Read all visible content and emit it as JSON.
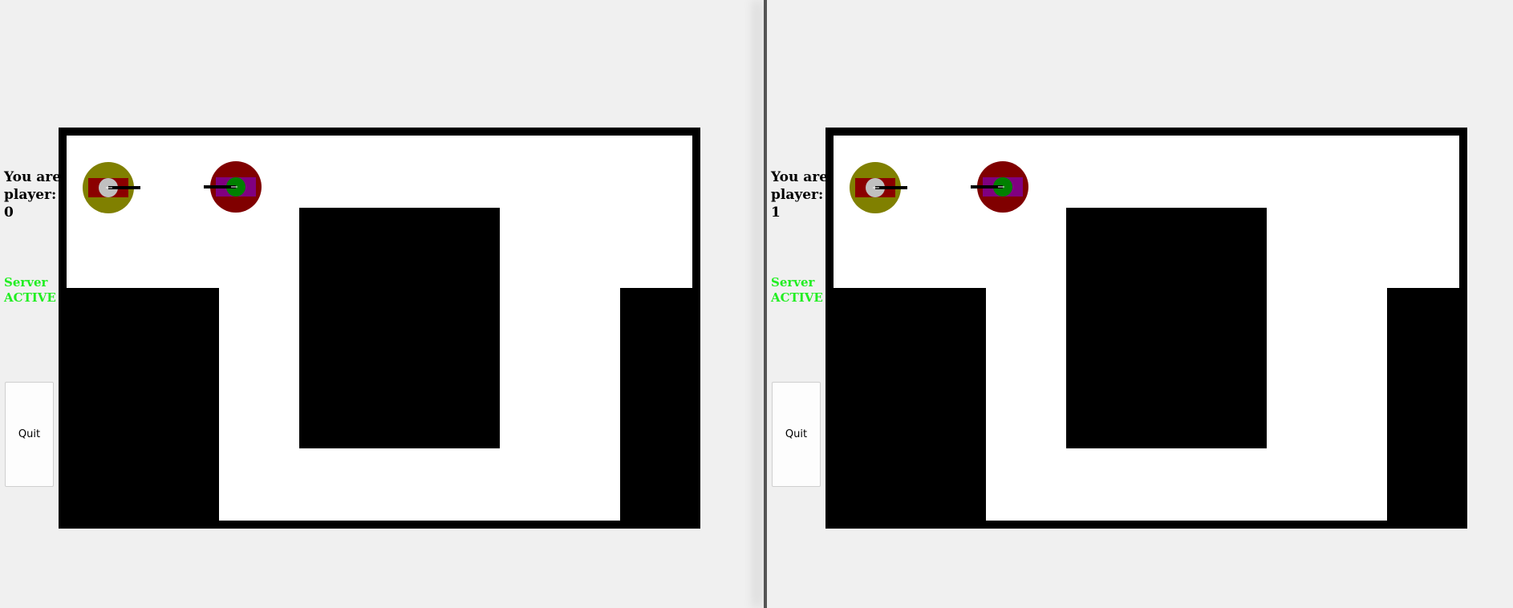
{
  "colors": {
    "wall": "#000000",
    "floor": "#ffffff",
    "server_active": "#22ee22",
    "tank0_outer": "#808000",
    "tank0_body": "#8b0000",
    "tank0_turret": "#c0c0c0",
    "tank1_outer": "#800000",
    "tank1_body": "#800080",
    "tank1_turret": "#008000"
  },
  "windows": [
    {
      "player_label": "You are player: 0",
      "server_status": "Server ACTIVE",
      "quit_label": "Quit"
    },
    {
      "player_label": "You are player: 1",
      "server_status": "Server ACTIVE",
      "quit_label": "Quit"
    }
  ],
  "tanks": [
    {
      "player": 0,
      "heading": "right",
      "icon": "tank-icon"
    },
    {
      "player": 1,
      "heading": "left",
      "icon": "tank-icon"
    }
  ]
}
